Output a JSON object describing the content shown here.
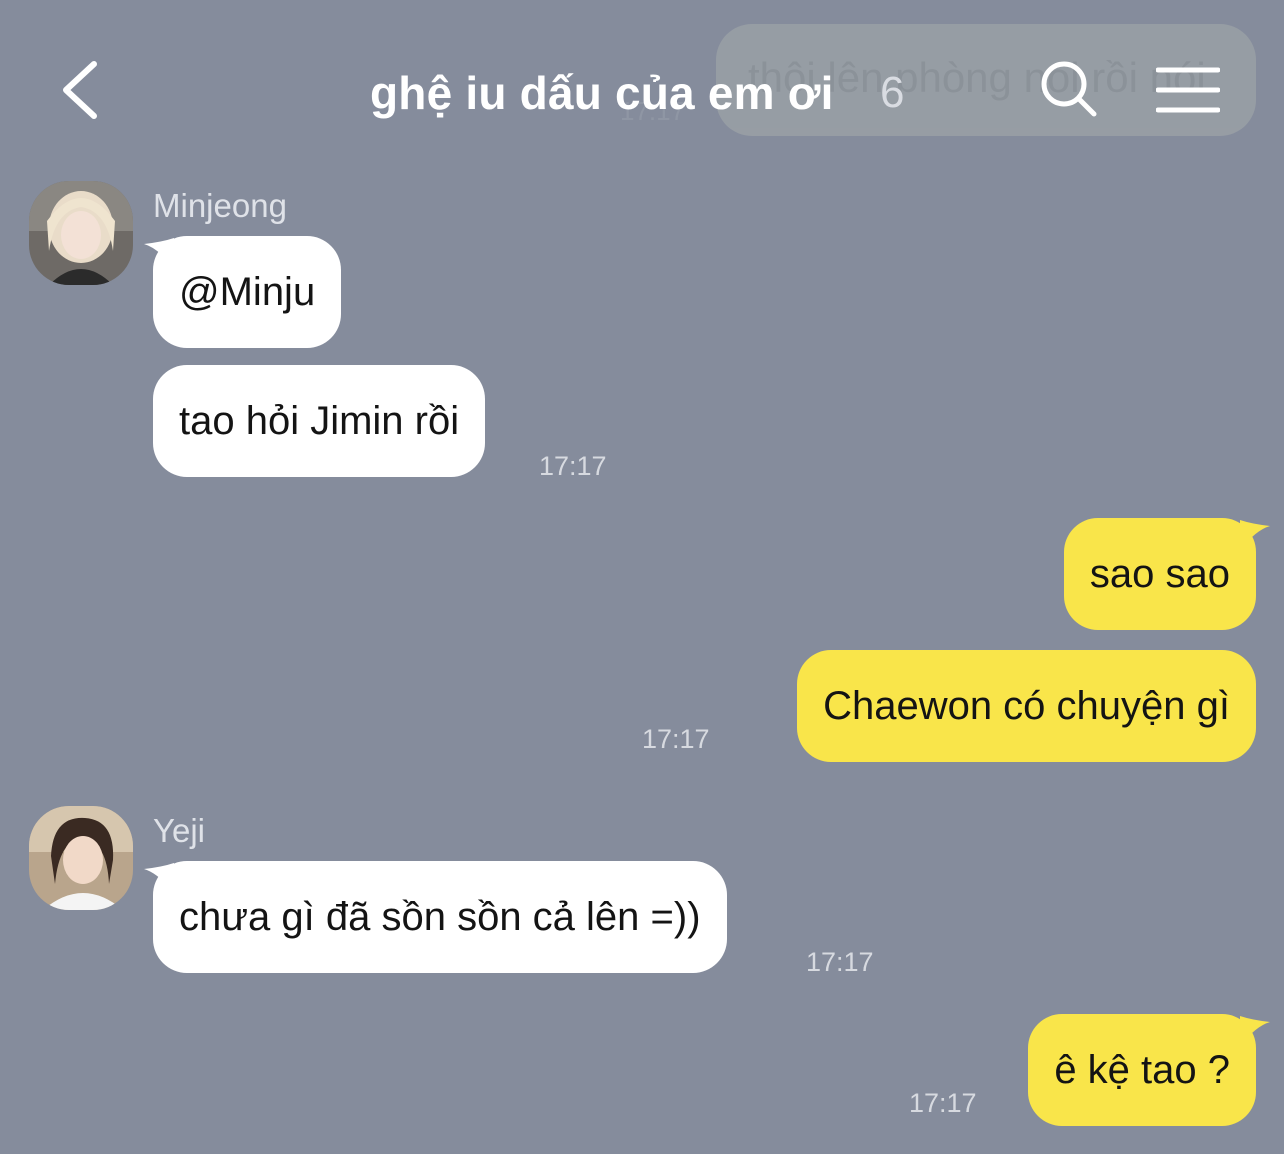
{
  "app": {
    "background_color": "#858c9c",
    "incoming_bubble_color": "#ffffff",
    "outgoing_bubble_color": "#f9e54a"
  },
  "header": {
    "title": "ghệ iu dấu của em ơi",
    "member_count": "6",
    "back_icon": "chevron-left-icon",
    "search_icon": "search-icon",
    "menu_icon": "menu-icon"
  },
  "ghost_message": {
    "text": "thôi lên phòng nói rồi nói",
    "time": "17:17"
  },
  "messages": [
    {
      "sender": "Minjeong",
      "direction": "incoming",
      "bubbles": [
        "@Minju",
        "tao hỏi Jimin rồi"
      ],
      "time": "17:17"
    },
    {
      "sender": "",
      "direction": "outgoing",
      "bubbles": [
        "sao sao",
        "Chaewon có chuyện gì"
      ],
      "time": "17:17"
    },
    {
      "sender": "Yeji",
      "direction": "incoming",
      "bubbles": [
        "chưa gì đã sồn sồn cả lên =))"
      ],
      "time": "17:17"
    },
    {
      "sender": "",
      "direction": "outgoing",
      "bubbles": [
        "ê kệ tao ?"
      ],
      "time": "17:17"
    }
  ]
}
